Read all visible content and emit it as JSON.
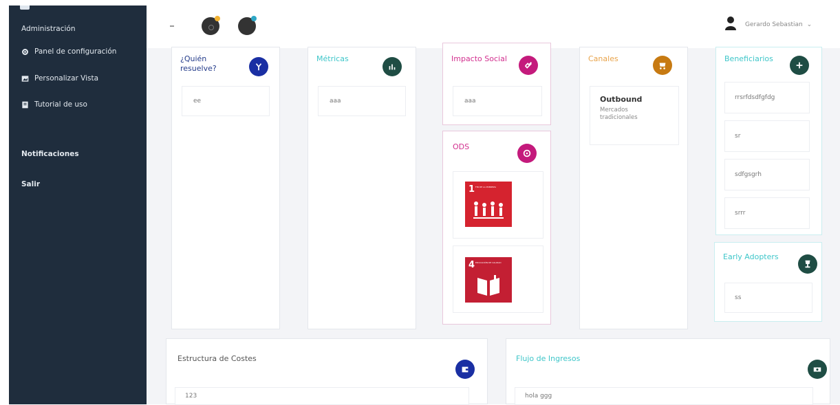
{
  "sidebar": {
    "header": "Administración",
    "items": [
      {
        "label": "Panel de configuración",
        "icon": "gear-icon"
      },
      {
        "label": "Personalizar Vista",
        "icon": "image-icon"
      },
      {
        "label": "Tutorial de uso",
        "icon": "book-icon"
      }
    ],
    "notifications": "Notificaciones",
    "logout": "Salir"
  },
  "topbar": {
    "collapse_icon": "minus-icon",
    "user_name": "Gerardo Sebastian"
  },
  "cards": {
    "quien": {
      "title": "¿Quién resuelve?",
      "items": [
        "ee"
      ],
      "color": "#1a2fa3"
    },
    "metricas": {
      "title": "Métricas",
      "items": [
        "aaa"
      ],
      "color": "#1f4d44"
    },
    "impacto": {
      "title": "Impacto Social",
      "items": [
        "aaa"
      ],
      "color": "#c41a7c"
    },
    "ods": {
      "title": "ODS",
      "color": "#c41a7c",
      "badges": [
        {
          "number": "1",
          "caption": "FIN DE LA POBREZA"
        },
        {
          "number": "4",
          "caption": "EDUCACIÓN DE CALIDAD"
        }
      ]
    },
    "canales": {
      "title": "Canales",
      "color": "#c77a12",
      "heading": "Outbound",
      "body": "Mercados tradicionales"
    },
    "beneficiarios": {
      "title": "Beneficiarios",
      "color": "#1f4d44",
      "items": [
        "rrsrfdsdfgfdg",
        "sr",
        "sdfgsgrh",
        "srrr"
      ]
    },
    "early": {
      "title": "Early Adopters",
      "color": "#1f4d44",
      "items": [
        "ss"
      ]
    },
    "costes": {
      "title": "Estructura de Costes",
      "color": "#1a2fa3",
      "items": [
        "123"
      ]
    },
    "ingresos": {
      "title": "Flujo de Ingresos",
      "color": "#1f4d44",
      "items": [
        "hola ggg"
      ]
    }
  }
}
